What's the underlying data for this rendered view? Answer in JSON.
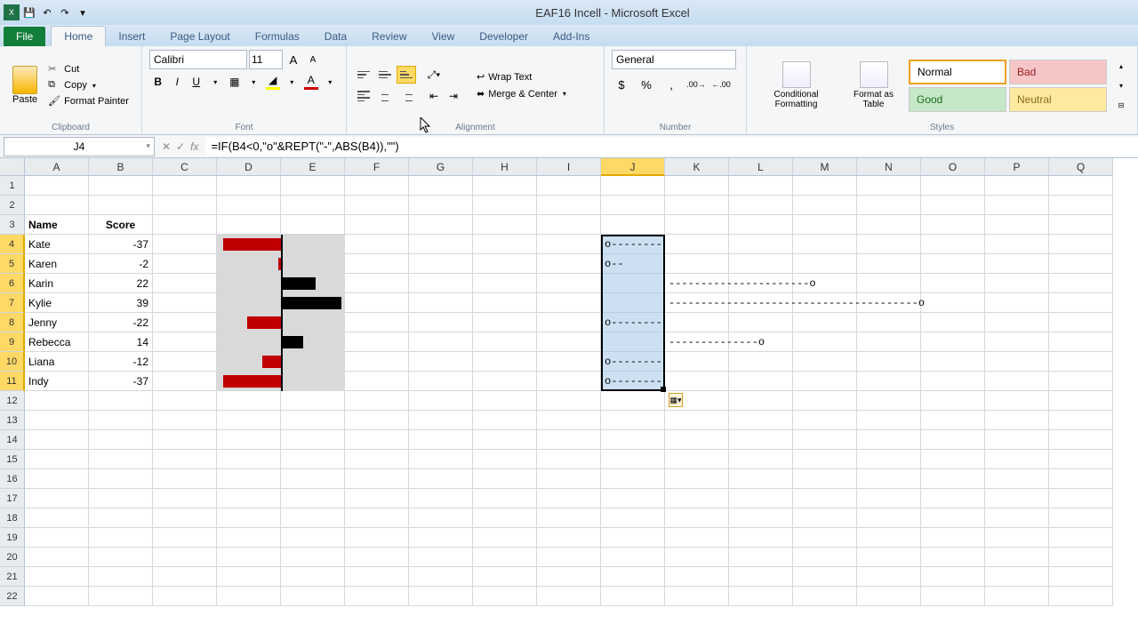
{
  "title": "EAF16 Incell  -  Microsoft Excel",
  "tabs": {
    "file": "File",
    "home": "Home",
    "insert": "Insert",
    "pagelayout": "Page Layout",
    "formulas": "Formulas",
    "data": "Data",
    "review": "Review",
    "view": "View",
    "developer": "Developer",
    "addins": "Add-Ins"
  },
  "clipboard": {
    "paste": "Paste",
    "cut": "Cut",
    "copy": "Copy",
    "fmtpainter": "Format Painter",
    "label": "Clipboard"
  },
  "font": {
    "name": "Calibri",
    "size": "11",
    "label": "Font"
  },
  "alignment": {
    "wrap": "Wrap Text",
    "merge": "Merge & Center",
    "label": "Alignment"
  },
  "number": {
    "format": "General",
    "label": "Number"
  },
  "styles": {
    "cond": "Conditional Formatting",
    "table": "Format as Table",
    "normal": "Normal",
    "bad": "Bad",
    "good": "Good",
    "neutral": "Neutral",
    "label": "Styles"
  },
  "namebox": "J4",
  "formula": "=IF(B4<0,\"o\"&REPT(\"-\",ABS(B4)),\"\")",
  "columns": [
    "A",
    "B",
    "C",
    "D",
    "E",
    "F",
    "G",
    "H",
    "I",
    "J",
    "K",
    "L",
    "M",
    "N",
    "O",
    "P",
    "Q"
  ],
  "headers": {
    "name": "Name",
    "score": "Score"
  },
  "rows": [
    {
      "name": "Kate",
      "score": -37
    },
    {
      "name": "Karen",
      "score": -2
    },
    {
      "name": "Karin",
      "score": 22
    },
    {
      "name": "Kylie",
      "score": 39
    },
    {
      "name": "Jenny",
      "score": -22
    },
    {
      "name": "Rebecca",
      "score": 14
    },
    {
      "name": "Liana",
      "score": -12
    },
    {
      "name": "Indy",
      "score": -37
    }
  ],
  "j_negatives": [
    "o-------------------------------------",
    "o--",
    "",
    "",
    "o----------------------",
    "",
    "o------------",
    "o-------------------------------------"
  ],
  "k_positives": [
    "",
    "",
    "----------------------o",
    "---------------------------------------o",
    "",
    "--------------o",
    "",
    ""
  ],
  "chart_data": {
    "type": "bar",
    "orientation": "horizontal",
    "categories": [
      "Kate",
      "Karen",
      "Karin",
      "Kylie",
      "Jenny",
      "Rebecca",
      "Liana",
      "Indy"
    ],
    "values": [
      -37,
      -2,
      22,
      39,
      -22,
      14,
      -12,
      -37
    ],
    "title": "",
    "xlabel": "",
    "ylabel": "",
    "xlim": [
      -40,
      40
    ],
    "colors": {
      "negative": "#c00000",
      "positive": "#000000"
    }
  }
}
